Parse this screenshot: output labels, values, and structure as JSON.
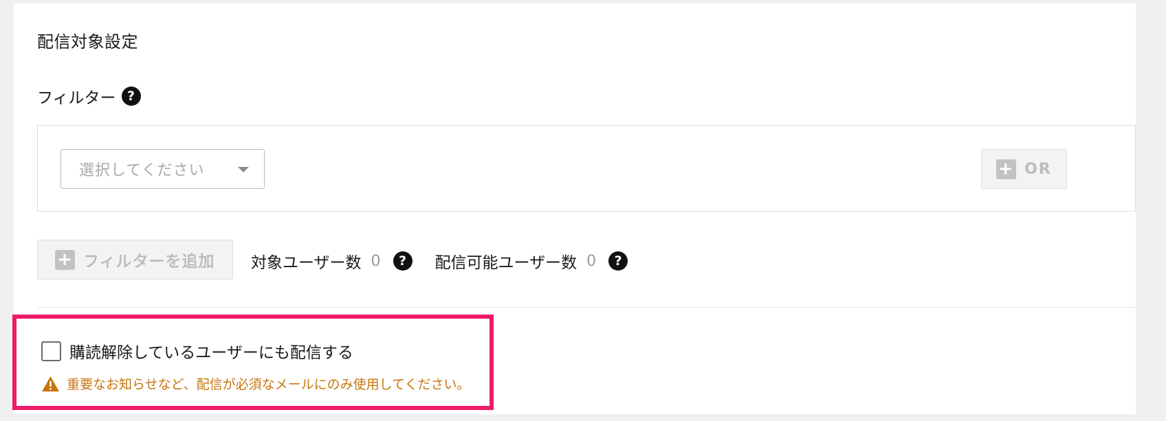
{
  "section": {
    "title": "配信対象設定"
  },
  "filter": {
    "label": "フィルター",
    "help_glyph": "?",
    "select_placeholder": "選択してください",
    "or_button_label": "OR",
    "add_filter_label": "フィルターを追加",
    "plus_glyph": "+"
  },
  "counts": {
    "target_users_label": "対象ユーザー数",
    "target_users_value": "0",
    "deliverable_users_label": "配信可能ユーザー数",
    "deliverable_users_value": "0"
  },
  "unsubscribed": {
    "checkbox_label": "購読解除しているユーザーにも配信する",
    "checked": false,
    "warning_text": "重要なお知らせなど、配信が必須なメールにのみ使用してください。"
  },
  "colors": {
    "highlight_border": "#ee1b6b",
    "warning_text": "#c8750e",
    "disabled_text": "#bdbdbd"
  },
  "icons": {
    "help": "question-circle-icon",
    "caret": "caret-down-icon",
    "plus": "plus-square-icon",
    "warning": "warning-triangle-icon"
  }
}
